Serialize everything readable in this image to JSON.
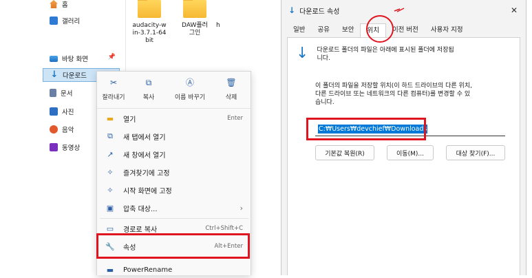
{
  "explorer": {
    "sidebar": [
      {
        "label": "홈",
        "icon": "home-icon"
      },
      {
        "label": "갤러리",
        "icon": "gallery-icon"
      },
      {
        "label": "바탕 화면",
        "icon": "desktop-icon",
        "pinned": true
      },
      {
        "label": "다운로드",
        "icon": "download-icon",
        "selected": true
      },
      {
        "label": "문서",
        "icon": "document-icon"
      },
      {
        "label": "사진",
        "icon": "pictures-icon"
      },
      {
        "label": "음악",
        "icon": "music-icon"
      },
      {
        "label": "동영상",
        "icon": "video-icon"
      }
    ],
    "files": [
      {
        "name": "audacity-win-3.7.1-64bit",
        "line1": "audacity-w",
        "line2": "in-3.7.1-64",
        "line3": "bit"
      },
      {
        "name": "DAW플러그인",
        "line1": "DAW플러",
        "line2": "그인",
        "line3": ""
      },
      {
        "name": "h",
        "line1": "h",
        "line2": "",
        "line3": ""
      }
    ]
  },
  "context_menu": {
    "toolbar": [
      {
        "label": "잘라내기",
        "icon": "cut-icon"
      },
      {
        "label": "복사",
        "icon": "copy-icon"
      },
      {
        "label": "이름 바꾸기",
        "icon": "rename-icon"
      },
      {
        "label": "삭제",
        "icon": "delete-icon"
      }
    ],
    "items": [
      {
        "label": "열기",
        "shortcut": "Enter",
        "icon": "folder-open-icon"
      },
      {
        "label": "새 탭에서 열기",
        "shortcut": "",
        "icon": "new-tab-icon"
      },
      {
        "label": "새 창에서 열기",
        "shortcut": "",
        "icon": "new-window-icon"
      },
      {
        "label": "즐겨찾기에 고정",
        "shortcut": "",
        "icon": "pin-icon"
      },
      {
        "label": "시작 화면에 고정",
        "shortcut": "",
        "icon": "pin-start-icon"
      },
      {
        "label": "압축 대상...",
        "shortcut": "›",
        "icon": "archive-icon"
      },
      {
        "label": "경로로 복사",
        "shortcut": "Ctrl+Shift+C",
        "icon": "copy-path-icon"
      },
      {
        "label": "속성",
        "shortcut": "Alt+Enter",
        "icon": "properties-icon"
      },
      {
        "label": "PowerRename",
        "shortcut": "",
        "icon": "power-rename-icon"
      }
    ]
  },
  "dialog": {
    "title": "다운로드 속성",
    "close": "✕",
    "tabs": [
      "일반",
      "공유",
      "보안",
      "위치",
      "이전 버전",
      "사용자 지정"
    ],
    "active_tab": "위치",
    "info_line1": "다운로드 폴더의 파일은 아래에 표시된 폴더에 저장됩",
    "info_line2": "니다.",
    "desc_line1": "이 폴더의 파일을 저장할 위치(이 하드 드라이브의 다른 위치,",
    "desc_line2": "다른 드라이브 또는 네트워크의 다른 컴퓨터)를 변경할 수 있",
    "desc_line3": "습니다.",
    "path": "C:₩Users₩devchief₩Downloads",
    "buttons": {
      "restore": "기본값 복원(R)",
      "move": "이동(M)...",
      "find_target": "대상 찾기(F)..."
    }
  },
  "colors": {
    "highlight_red": "#e0141e",
    "selection_blue": "#0078d7",
    "sidebar_selected": "#cde4f7"
  }
}
